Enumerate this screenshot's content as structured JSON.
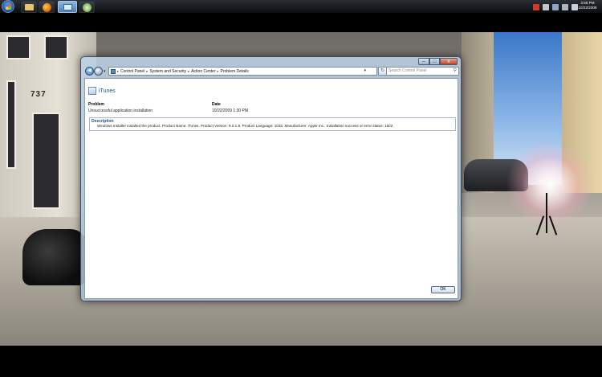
{
  "taskbar": {
    "icons": [
      "windows-orb",
      "explorer-icon",
      "firefox-icon",
      "control-panel-icon",
      "performance-icon"
    ],
    "clock": {
      "time": "2:55 PM",
      "date": "10/22/2009"
    }
  },
  "window": {
    "controls": {
      "minimize": "–",
      "maximize": "□",
      "close": "x"
    },
    "nav": {
      "back": "◀",
      "forward": "▶",
      "dropdown": "▾",
      "refresh": "↻"
    },
    "breadcrumb": [
      "Control Panel",
      "System and Security",
      "Action Center",
      "Problem Details"
    ],
    "search_placeholder": "Search Control Panel",
    "app_name": "iTunes",
    "problem_header": "Problem",
    "problem_value": "Unsuccessful application installation",
    "date_header": "Date",
    "date_value": "10/22/2009 1:30 PM",
    "description_header": "Description",
    "description_text": "Windows Installer installed the product. Product Name: iTunes. Product Version: 9.0.1.8. Product Language: 1033. Manufacturer: Apple Inc.. Installation success or error status: 1602.",
    "ok_label": "OK"
  },
  "desktop": {
    "building_number": "737"
  }
}
